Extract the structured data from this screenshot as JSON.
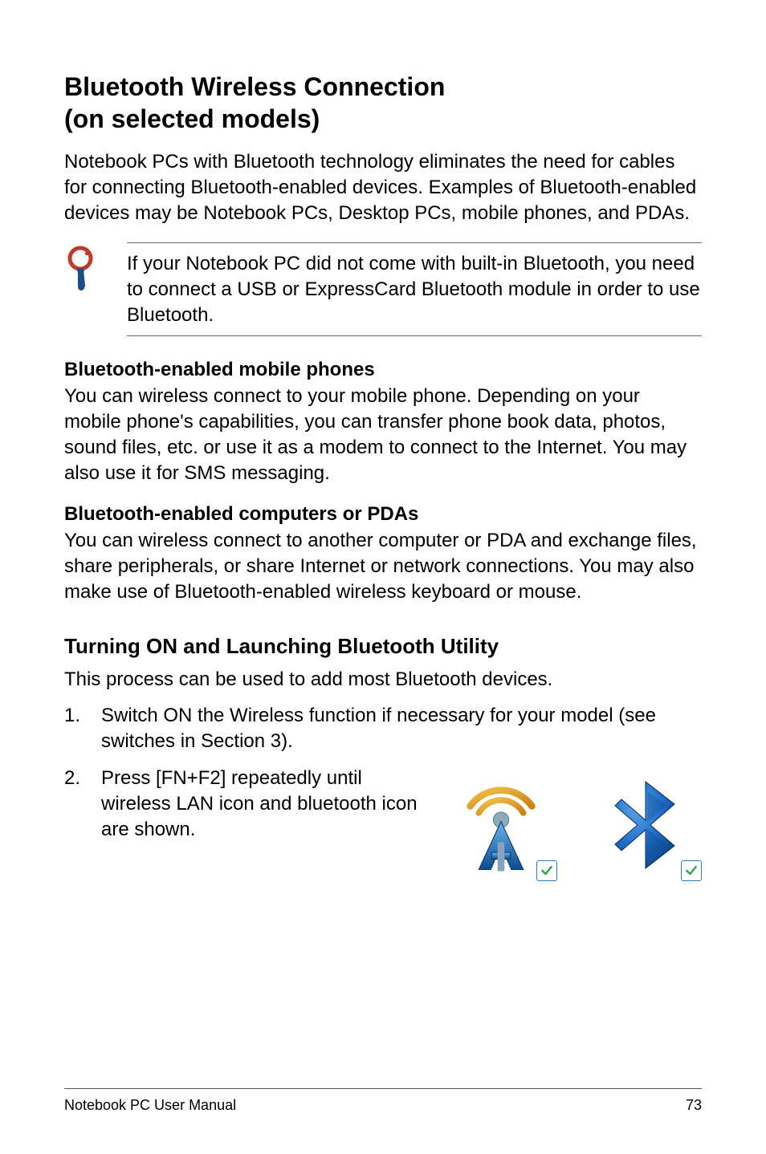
{
  "heading": {
    "title_line1": "Bluetooth Wireless Connection",
    "title_line2": "(on selected models)"
  },
  "intro_paragraph": "Notebook PCs with Bluetooth technology eliminates the need for cables for connecting Bluetooth-enabled devices. Examples of Bluetooth-enabled devices may be Notebook PCs, Desktop PCs, mobile phones, and PDAs.",
  "note": {
    "text": "If your Notebook PC did not come with built-in Bluetooth, you need to connect a USB or ExpressCard Bluetooth module in order to use Bluetooth."
  },
  "sections": [
    {
      "heading": "Bluetooth-enabled mobile phones",
      "body": "You can wireless connect to your mobile phone. Depending on your mobile phone's capabilities, you can transfer phone book data, photos, sound files, etc. or use it as a modem to connect to the Internet. You may also use it for SMS messaging."
    },
    {
      "heading": "Bluetooth-enabled computers or PDAs",
      "body": "You can wireless connect to another computer or PDA and exchange files, share peripherals, or share Internet or network connections. You may also make use of Bluetooth-enabled wireless keyboard or mouse."
    }
  ],
  "utility": {
    "heading": "Turning ON and Launching Bluetooth Utility",
    "intro": "This process can be used to add most Bluetooth devices.",
    "steps": [
      {
        "num": "1.",
        "text": "Switch ON the Wireless function if necessary for your model (see switches in Section 3)."
      },
      {
        "num": "2.",
        "text": "Press [FN+F2] repeatedly until wireless LAN icon and bluetooth icon are shown."
      }
    ]
  },
  "icons": {
    "wlan": "wlan-antenna-icon",
    "bluetooth": "bluetooth-icon"
  },
  "footer": {
    "title": "Notebook PC User Manual",
    "page": "73"
  }
}
